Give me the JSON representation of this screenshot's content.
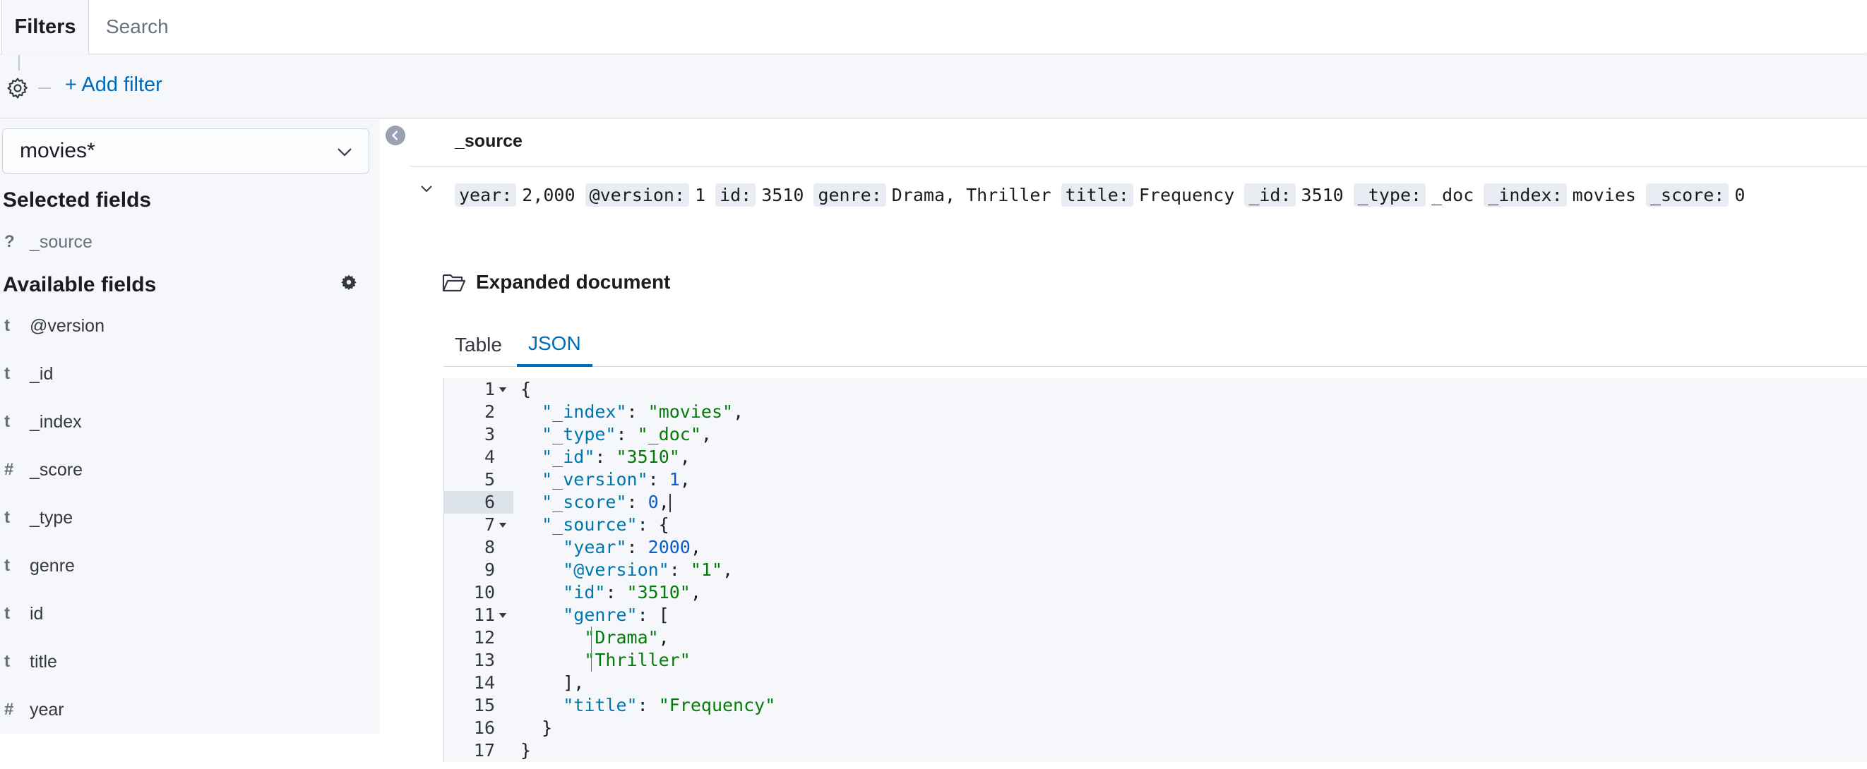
{
  "topbar": {
    "filters_label": "Filters",
    "search_placeholder": "Search"
  },
  "filterbar": {
    "add_filter_label": "+ Add filter"
  },
  "sidebar": {
    "index_pattern": "movies*",
    "selected_title": "Selected fields",
    "selected_fields": [
      {
        "type": "?",
        "name": "_source"
      }
    ],
    "available_title": "Available fields",
    "available_fields": [
      {
        "type": "t",
        "name": "@version"
      },
      {
        "type": "t",
        "name": "_id"
      },
      {
        "type": "t",
        "name": "_index"
      },
      {
        "type": "#",
        "name": "_score"
      },
      {
        "type": "t",
        "name": "_type"
      },
      {
        "type": "t",
        "name": "genre"
      },
      {
        "type": "t",
        "name": "id"
      },
      {
        "type": "t",
        "name": "title"
      },
      {
        "type": "#",
        "name": "year"
      }
    ]
  },
  "main": {
    "column_header": "_source",
    "source_row": [
      {
        "key": "year:",
        "value": "2,000"
      },
      {
        "key": "@version:",
        "value": "1"
      },
      {
        "key": "id:",
        "value": "3510"
      },
      {
        "key": "genre:",
        "value": "Drama, Thriller"
      },
      {
        "key": "title:",
        "value": "Frequency"
      },
      {
        "key": "_id:",
        "value": "3510"
      },
      {
        "key": "_type:",
        "value": "_doc"
      },
      {
        "key": "_index:",
        "value": "movies"
      },
      {
        "key": "_score:",
        "value": "0"
      }
    ],
    "expanded_title": "Expanded document",
    "tabs": [
      {
        "label": "Table"
      },
      {
        "label": "JSON"
      }
    ],
    "active_tab": "JSON",
    "json_lines": [
      {
        "n": "1",
        "fold": true
      },
      {
        "n": "2"
      },
      {
        "n": "3"
      },
      {
        "n": "4"
      },
      {
        "n": "5"
      },
      {
        "n": "6"
      },
      {
        "n": "7",
        "fold": true
      },
      {
        "n": "8"
      },
      {
        "n": "9"
      },
      {
        "n": "10"
      },
      {
        "n": "11",
        "fold": true
      },
      {
        "n": "12"
      },
      {
        "n": "13"
      },
      {
        "n": "14"
      },
      {
        "n": "15"
      },
      {
        "n": "16"
      },
      {
        "n": "17"
      }
    ],
    "json_tokens": {
      "l1": "{",
      "l2k": "\"_index\"",
      "l2v": "\"movies\"",
      "l3k": "\"_type\"",
      "l3v": "\"_doc\"",
      "l4k": "\"_id\"",
      "l4v": "\"3510\"",
      "l5k": "\"_version\"",
      "l5v": "1",
      "l6k": "\"_score\"",
      "l6v": "0",
      "l7k": "\"_source\"",
      "l8k": "\"year\"",
      "l8v": "2000",
      "l9k": "\"@version\"",
      "l9v": "\"1\"",
      "l10k": "\"id\"",
      "l10v": "\"3510\"",
      "l11k": "\"genre\"",
      "l12v": "\"Drama\"",
      "l13v": "\"Thriller\"",
      "l15k": "\"title\"",
      "l15v": "\"Frequency\""
    }
  },
  "colors": {
    "accent": "#006bb8",
    "sidebar_bg": "#f5f7fa",
    "string": "#067a0b",
    "key": "#0077aa"
  }
}
